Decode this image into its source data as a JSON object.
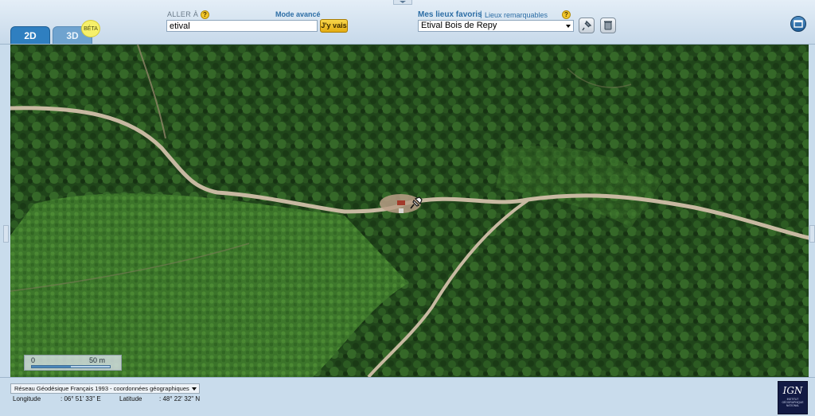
{
  "tabs": {
    "tab_2d": "2D",
    "tab_3d": "3D",
    "beta_badge": "BÉTA"
  },
  "goto": {
    "label": "ALLER À",
    "help": "?",
    "advanced_link": "Mode avancé",
    "value": "etival",
    "button": "J'y vais"
  },
  "favorites": {
    "title": "Mes lieux favoris",
    "separator": "|",
    "landmarks_link": "Lieux remarquables",
    "help": "?",
    "selected": "Etival Bois de Repy"
  },
  "map": {
    "scale_zero": "0",
    "scale_distance": "50 m",
    "pin_icon": "pushpin-icon"
  },
  "coordinates": {
    "crs": "Réseau Géodésique Français 1993 - coordonnées géographiques",
    "longitude_label": "Longitude",
    "longitude_value": ": 06° 51' 33\" E",
    "latitude_label": "Latitude",
    "latitude_value": ": 48° 22' 32\" N"
  },
  "logo": {
    "letters": "IGN",
    "caption": "INSTITUT\nGÉOGRAPHIQUE\nNATIONAL"
  },
  "colors": {
    "accent": "#2f7fc0",
    "panel": "#c9dcec",
    "forest": "#244a1c",
    "road": "#c7b9a1"
  }
}
